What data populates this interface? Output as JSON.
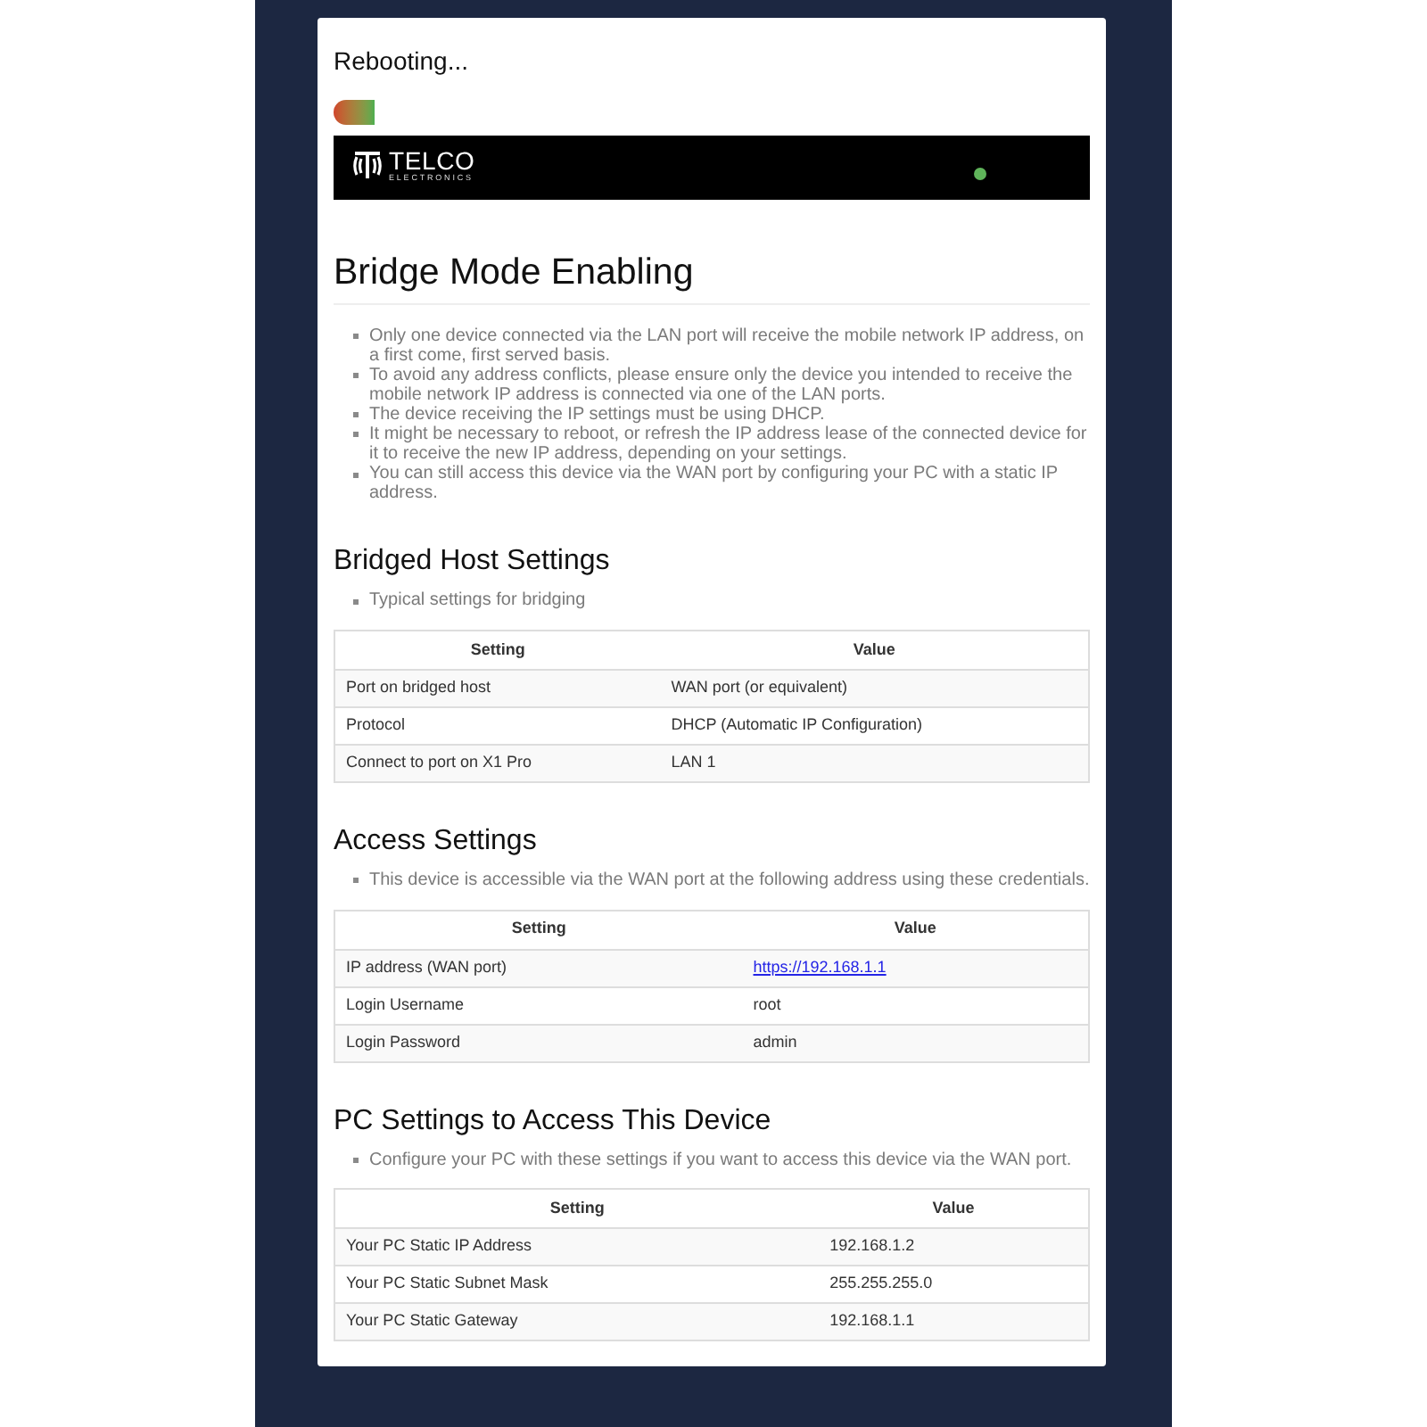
{
  "status": {
    "title": "Rebooting..."
  },
  "banner": {
    "brand": "TELCO",
    "tagline": "ELECTRONICS",
    "online": true
  },
  "sections": [
    {
      "kind": "title",
      "heading": "Bridge Mode Enabling",
      "notes": [
        "Only one device connected via the LAN port will receive the mobile network IP address, on a first come, first served basis.",
        "To avoid any address conflicts, please ensure only the device you intended to receive the mobile network IP address is connected via one of the LAN ports.",
        "The device receiving the IP settings must be using DHCP.",
        "It might be necessary to reboot, or refresh the IP address lease of the connected device for it to receive the new IP address, depending on your settings.",
        "You can still access this device via the WAN port by configuring your PC with a static IP address."
      ]
    },
    {
      "kind": "subsection",
      "heading": "Bridged Host Settings",
      "notes": [
        "Typical settings for bridging"
      ],
      "table": {
        "columns": [
          "Setting",
          "Value"
        ],
        "rows": [
          {
            "setting": "Port on bridged host",
            "value": "WAN port (or equivalent)",
            "link": false
          },
          {
            "setting": "Protocol",
            "value": "DHCP (Automatic IP Configuration)",
            "link": false
          },
          {
            "setting": "Connect to port on X1 Pro",
            "value": "LAN 1",
            "link": false
          }
        ]
      }
    },
    {
      "kind": "subsection",
      "heading": "Access Settings",
      "notes": [
        "This device is accessible via the WAN port at the following address using these credentials."
      ],
      "table": {
        "columns": [
          "Setting",
          "Value"
        ],
        "rows": [
          {
            "setting": "IP address (WAN port)",
            "value": "https://192.168.1.1",
            "link": true
          },
          {
            "setting": "Login Username",
            "value": "root",
            "link": false
          },
          {
            "setting": "Login Password",
            "value": "admin",
            "link": false
          }
        ]
      }
    },
    {
      "kind": "subsection",
      "heading": "PC Settings to Access This Device",
      "notes": [
        "Configure your PC with these settings if you want to access this device via the WAN port."
      ],
      "table": {
        "columns": [
          "Setting",
          "Value"
        ],
        "rows": [
          {
            "setting": "Your PC Static IP Address",
            "value": "192.168.1.2",
            "link": false
          },
          {
            "setting": "Your PC Static Subnet Mask",
            "value": "255.255.255.0",
            "link": false
          },
          {
            "setting": "Your PC Static Gateway",
            "value": "192.168.1.1",
            "link": false
          }
        ]
      }
    }
  ]
}
